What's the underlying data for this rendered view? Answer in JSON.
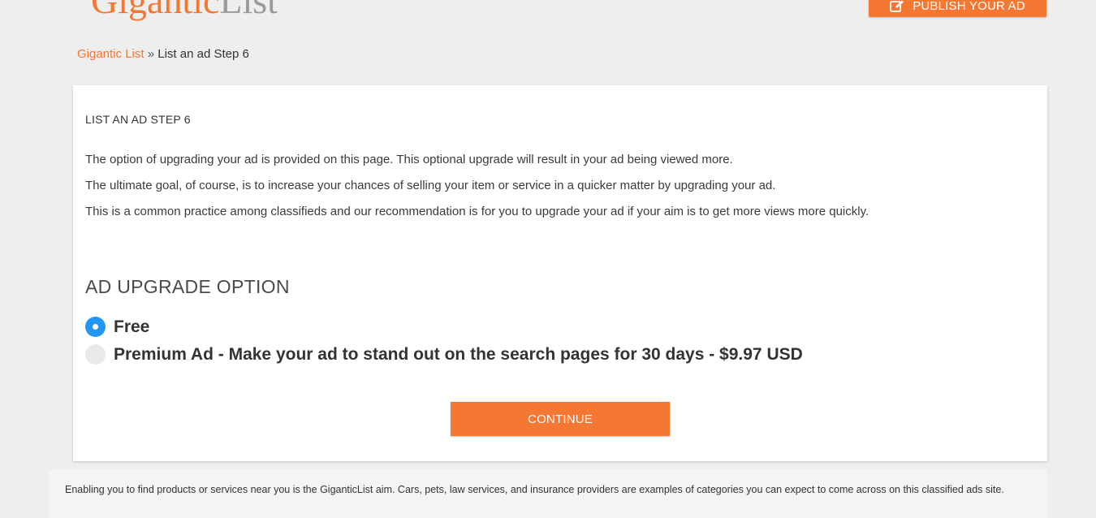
{
  "header": {
    "logo_part1": "Gigantic",
    "logo_part2": "List",
    "publish_button_label": "PUBLISH YOUR AD",
    "publish_button_icon": "edit-icon"
  },
  "breadcrumb": {
    "home_label": "Gigantic List",
    "separator": "»",
    "current_label": "List an ad Step 6"
  },
  "main": {
    "step_title": "LIST AN AD STEP 6",
    "paragraphs": [
      "The option of upgrading your ad is provided on this page. This optional upgrade will result in your ad being viewed more.",
      "The ultimate goal, of course, is to increase your chances of selling your item or service in a quicker matter by upgrading your ad.",
      "This is a common practice among classifieds and our recommendation is for you to upgrade your ad if your aim is to get more views more quickly."
    ],
    "upgrade_heading": "AD UPGRADE OPTION",
    "options": [
      {
        "label": "Free",
        "selected": true
      },
      {
        "label": "Premium Ad - Make your ad to stand out on the search pages for 30 days - $9.97 USD",
        "selected": false
      }
    ],
    "continue_label": "CONTINUE"
  },
  "footer": {
    "text": "Enabling you to find products or services near you is the GiganticList aim. Cars, pets, law services, and insurance providers are examples of categories you can expect to come across on this classified ads site."
  },
  "colors": {
    "accent": "#f47733",
    "radio_selected": "#2196f3",
    "background": "#eeeeee"
  }
}
